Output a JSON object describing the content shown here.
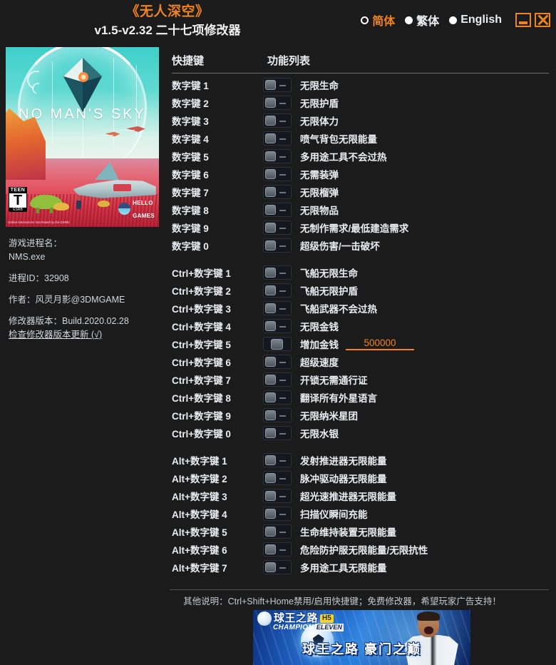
{
  "window": {
    "game_title": "《无人深空》",
    "version_title": "v1.5-v2.32  二十七项修改器",
    "minimize_label": "_",
    "close_label": "X",
    "accent_color": "#ef8321",
    "background_color": "#1b1b1b",
    "text_color": "#e9edf2"
  },
  "languages": [
    {
      "label": "简体",
      "selected": true
    },
    {
      "label": "繁体",
      "selected": false
    },
    {
      "label": "English",
      "selected": false
    }
  ],
  "cover": {
    "game_name": "NO MAN'S SKY",
    "rating_top": "TEEN",
    "rating_letter": "T",
    "rating_bottom": "ESRB",
    "rating_note": "Online Interactions Not\nRated by the ESRB",
    "publisher_line1": "HELLO",
    "publisher_line2": "GAMES"
  },
  "info": {
    "process_name_label": "游戏进程名：",
    "process_name_value": "NMS.exe",
    "process_id": "进程ID：32908",
    "author": "作者：风灵月影@3DMGAME",
    "trainer_version": "修改器版本：Build.2020.02.28",
    "update_link": "检查修改器版本更新 (√)"
  },
  "table": {
    "hotkey_header": "快捷键",
    "function_header": "功能列表",
    "groups": [
      {
        "rows": [
          {
            "hotkey": "数字键 1",
            "func": "无限生命",
            "toggle": "off"
          },
          {
            "hotkey": "数字键 2",
            "func": "无限护盾",
            "toggle": "off"
          },
          {
            "hotkey": "数字键 3",
            "func": "无限体力",
            "toggle": "off"
          },
          {
            "hotkey": "数字键 4",
            "func": "喷气背包无限能量",
            "toggle": "off"
          },
          {
            "hotkey": "数字键 5",
            "func": "多用途工具不会过热",
            "toggle": "off"
          },
          {
            "hotkey": "数字键 6",
            "func": "无需装弹",
            "toggle": "off"
          },
          {
            "hotkey": "数字键 7",
            "func": "无限榴弹",
            "toggle": "off"
          },
          {
            "hotkey": "数字键 8",
            "func": "无限物品",
            "toggle": "off"
          },
          {
            "hotkey": "数字键 9",
            "func": "无制作需求/最低建造需求",
            "toggle": "off"
          },
          {
            "hotkey": "数字键 0",
            "func": "超级伤害/一击破坏",
            "toggle": "off"
          }
        ]
      },
      {
        "rows": [
          {
            "hotkey": "Ctrl+数字键 1",
            "func": "飞船无限生命",
            "toggle": "off"
          },
          {
            "hotkey": "Ctrl+数字键 2",
            "func": "飞船无限护盾",
            "toggle": "off"
          },
          {
            "hotkey": "Ctrl+数字键 3",
            "func": "飞船武器不会过热",
            "toggle": "off"
          },
          {
            "hotkey": "Ctrl+数字键 4",
            "func": "无限金钱",
            "toggle": "off"
          },
          {
            "hotkey": "Ctrl+数字键 5",
            "func": "增加金钱",
            "toggle": "wide",
            "value": "500000"
          },
          {
            "hotkey": "Ctrl+数字键 6",
            "func": "超级速度",
            "toggle": "off"
          },
          {
            "hotkey": "Ctrl+数字键 7",
            "func": "开锁无需通行证",
            "toggle": "off"
          },
          {
            "hotkey": "Ctrl+数字键 8",
            "func": "翻译所有外星语言",
            "toggle": "off"
          },
          {
            "hotkey": "Ctrl+数字键 9",
            "func": "无限纳米星团",
            "toggle": "off"
          },
          {
            "hotkey": "Ctrl+数字键 0",
            "func": "无限水银",
            "toggle": "off"
          }
        ]
      },
      {
        "rows": [
          {
            "hotkey": "Alt+数字键 1",
            "func": "发射推进器无限能量",
            "toggle": "off"
          },
          {
            "hotkey": "Alt+数字键 2",
            "func": "脉冲驱动器无限能量",
            "toggle": "off"
          },
          {
            "hotkey": "Alt+数字键 3",
            "func": "超光速推进器无限能量",
            "toggle": "off"
          },
          {
            "hotkey": "Alt+数字键 4",
            "func": "扫描仪瞬间充能",
            "toggle": "off"
          },
          {
            "hotkey": "Alt+数字键 5",
            "func": "生命维持装置无限能量",
            "toggle": "off"
          },
          {
            "hotkey": "Alt+数字键 6",
            "func": "危险防护服无限能量/无限抗性",
            "toggle": "off"
          },
          {
            "hotkey": "Alt+数字键 7",
            "func": "多用途工具无限能量",
            "toggle": "off"
          }
        ]
      }
    ]
  },
  "footer": {
    "note": "其他说明：Ctrl+Shift+Home禁用/启用快捷键；免费修改器，希望玩家广告支持！"
  },
  "ad": {
    "logo_cn": "球王之路",
    "logo_h5": "H5",
    "sub_a": "CHAMPION",
    "sub_b": "ELEVEN",
    "slogan": "球王之路 豪门之巅"
  }
}
